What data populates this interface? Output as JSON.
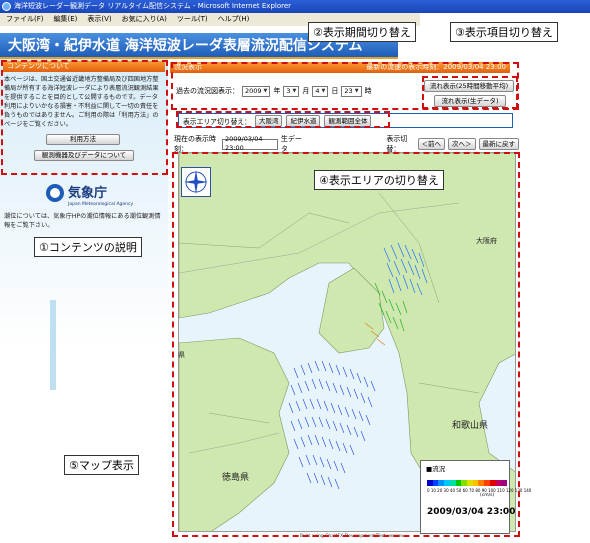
{
  "window": {
    "title": "海洋短波レーダー観測データ リアルタイム配信システム - Microsoft Internet Explorer"
  },
  "menu": [
    "ファイル(F)",
    "編集(E)",
    "表示(V)",
    "お気に入り(A)",
    "ツール(T)",
    "ヘルプ(H)"
  ],
  "banner": {
    "title": "大阪湾・紀伊水道 海洋短波レーダ表層流況配信システム"
  },
  "sidebar": {
    "header": "コンテンツについて",
    "description": "本ページは、国土交通省近畿地方整備局及び四国地方整備局が所有する海洋短波レーダにより表層流況観測結果を提供することを目的として公開するものです。データ利用によりいかなる損害・不利益に関して一切の責任を負うものではありません。ご利用の際は「利用方法」のページをご覧ください。",
    "buttons": [
      "利用方法",
      "観測機器及びデータについて"
    ],
    "jma_name": "気象庁",
    "jma_english": "Japan Meteorological Agency",
    "tide_text": "潮位については、気象庁HPの潮位情報にある潮位観測情報をご覧下さい。"
  },
  "panel": {
    "header": "流況表示",
    "latest_label": "最新の流速の表示時刻：",
    "latest_time": "2009/03/04 23:00",
    "period_label": "過去の流況図表示：",
    "year": "2009",
    "year_unit": "年",
    "month": "3",
    "month_unit": "月",
    "day": "4",
    "day_unit": "日",
    "hour": "23",
    "hour_unit": "時",
    "item_buttons": [
      "流れ表示(25時間移動平均)",
      "流れ表示(生データ)"
    ]
  },
  "area": {
    "label": "表示エリア切り替え：",
    "buttons": [
      "大阪湾",
      "紀伊水道",
      "観測範囲全体"
    ]
  },
  "time_row": {
    "label": "現在の表示時刻：",
    "value": "2009/03/04 23:00",
    "kind": "生データ",
    "switch_label": "表示切替：",
    "prev": "＜前へ",
    "next": "次へ＞",
    "latest": "最新に戻す"
  },
  "map": {
    "places": [
      "大阪府",
      "和歌山県",
      "徳島県",
      "県"
    ],
    "legend_title": "流況",
    "legend_numbers": "0 10 20 30 40 50 60 70 80 90 100 110 120 130 140",
    "legend_unit": "(cm/s)",
    "legend_time": "2009/03/04 23:00",
    "legend_colors": [
      "#0000c8",
      "#0040ff",
      "#0090ff",
      "#00c8ff",
      "#00e0a0",
      "#00c800",
      "#80e000",
      "#e0e000",
      "#ffc000",
      "#ff8000",
      "#ff4000",
      "#e00000",
      "#c00060",
      "#a00080"
    ],
    "credit": "Built using ChartFX Development/Test version"
  },
  "callouts": {
    "c1": "①コンテンツの説明",
    "c2": "②表示期間切り替え",
    "c3": "③表示項目切り替え",
    "c4": "④表示エリアの切り替え",
    "c5": "⑤マップ表示"
  }
}
